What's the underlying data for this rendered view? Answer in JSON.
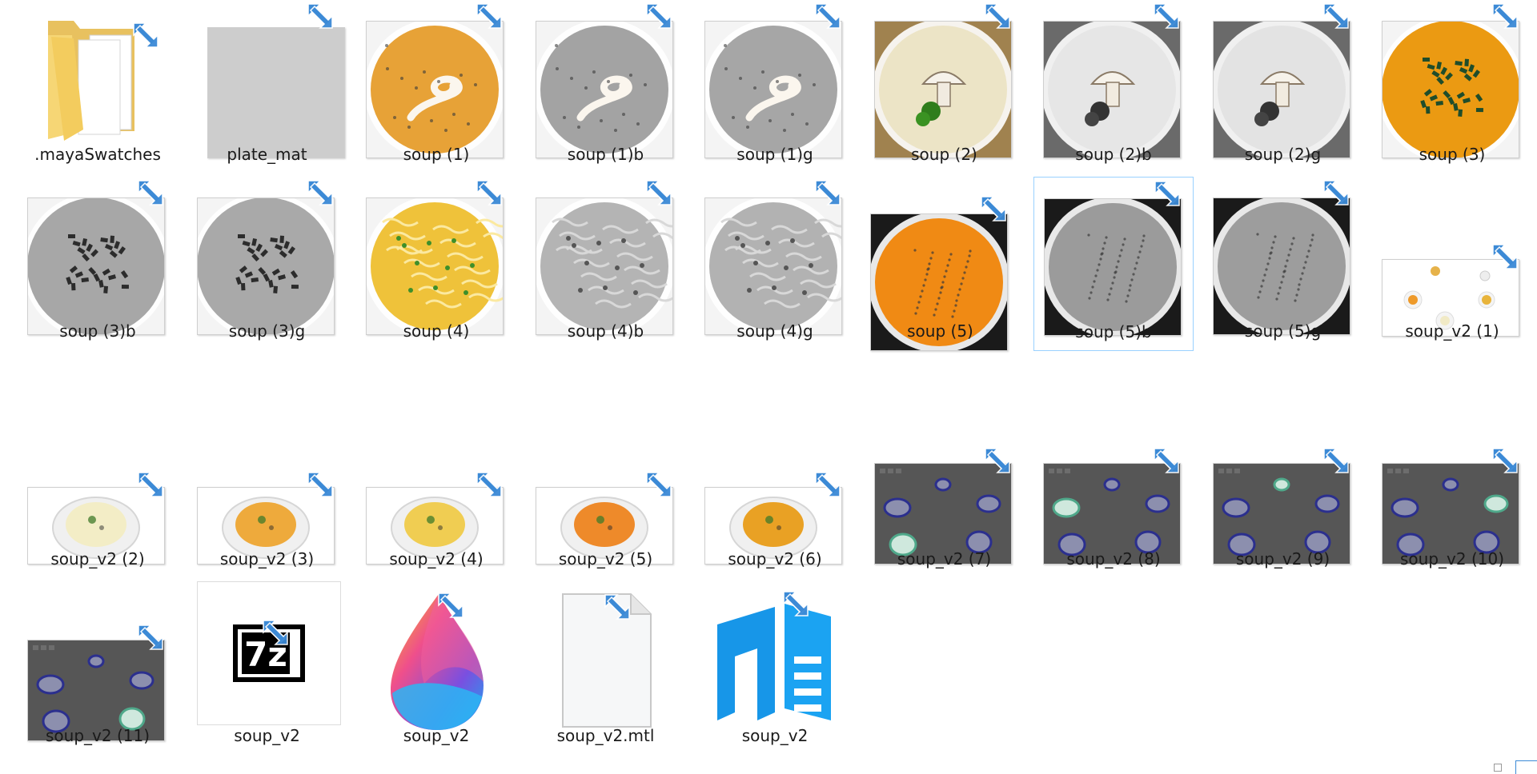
{
  "files": [
    {
      "label": ".mayaSwatches",
      "kind": "folder"
    },
    {
      "label": "plate_mat",
      "kind": "plain-gray"
    },
    {
      "label": "soup (1)",
      "kind": "soup",
      "style": "swirl",
      "color": "#e7a237"
    },
    {
      "label": "soup (1)b",
      "kind": "soup",
      "style": "swirl",
      "color": "#a3a3a3"
    },
    {
      "label": "soup (1)g",
      "kind": "soup",
      "style": "swirl",
      "color": "#a6a6a6"
    },
    {
      "label": "soup (2)",
      "kind": "soup",
      "style": "mushroom",
      "color": "#ece4c6"
    },
    {
      "label": "soup (2)b",
      "kind": "soup",
      "style": "mushroom",
      "color": "#e6e6e6"
    },
    {
      "label": "soup (2)g",
      "kind": "soup",
      "style": "mushroom",
      "color": "#e3e3e3"
    },
    {
      "label": "soup (3)",
      "kind": "soup",
      "style": "herbs",
      "color": "#eb9a12"
    },
    {
      "label": "soup (3)b",
      "kind": "soup",
      "style": "herbs",
      "color": "#a7a7a7"
    },
    {
      "label": "soup (3)g",
      "kind": "soup",
      "style": "herbs",
      "color": "#a9a9a9"
    },
    {
      "label": "soup (4)",
      "kind": "soup",
      "style": "noodle",
      "color": "#efc23a"
    },
    {
      "label": "soup (4)b",
      "kind": "soup",
      "style": "noodle",
      "color": "#b4b4b4"
    },
    {
      "label": "soup (4)g",
      "kind": "soup",
      "style": "noodle",
      "color": "#b2b2b2"
    },
    {
      "label": "soup (5)",
      "kind": "soup",
      "style": "puree",
      "color": "#f08a14"
    },
    {
      "label": "soup (5)b",
      "kind": "soup",
      "style": "puree",
      "color": "#9b9b9b",
      "selected": true
    },
    {
      "label": "soup (5)g",
      "kind": "soup",
      "style": "puree",
      "color": "#9d9d9d"
    },
    {
      "label": "soup_v2 (1)",
      "kind": "render-white",
      "style": "scatter"
    },
    {
      "label": "soup_v2 (2)",
      "kind": "render-white",
      "style": "bowl",
      "color": "#f3edc6"
    },
    {
      "label": "soup_v2 (3)",
      "kind": "render-white",
      "style": "bowl",
      "color": "#eeaa3c"
    },
    {
      "label": "soup_v2 (4)",
      "kind": "render-white",
      "style": "bowl",
      "color": "#f0cd52"
    },
    {
      "label": "soup_v2 (5)",
      "kind": "render-white",
      "style": "bowl",
      "color": "#ee8a2a"
    },
    {
      "label": "soup_v2 (6)",
      "kind": "render-white",
      "style": "bowl",
      "color": "#e9a124"
    },
    {
      "label": "soup_v2 (7)",
      "kind": "render-gray",
      "highlight": 3
    },
    {
      "label": "soup_v2 (8)",
      "kind": "render-gray",
      "highlight": 0
    },
    {
      "label": "soup_v2 (9)",
      "kind": "render-gray",
      "highlight": 1
    },
    {
      "label": "soup_v2 (10)",
      "kind": "render-gray",
      "highlight": 2
    },
    {
      "label": "soup_v2 (11)",
      "kind": "render-gray",
      "highlight": 4
    },
    {
      "label": "soup_v2",
      "kind": "archive-7z",
      "icon_text": "7z"
    },
    {
      "label": "soup_v2",
      "kind": "paint3d-app"
    },
    {
      "label": "soup_v2.mtl",
      "kind": "blank-doc"
    },
    {
      "label": "soup_v2",
      "kind": "notepadpp-app"
    }
  ],
  "colors": {
    "sync_blue": "#3c8ad6",
    "selection_border": "#99d1ff",
    "render_bg": "#565656"
  }
}
